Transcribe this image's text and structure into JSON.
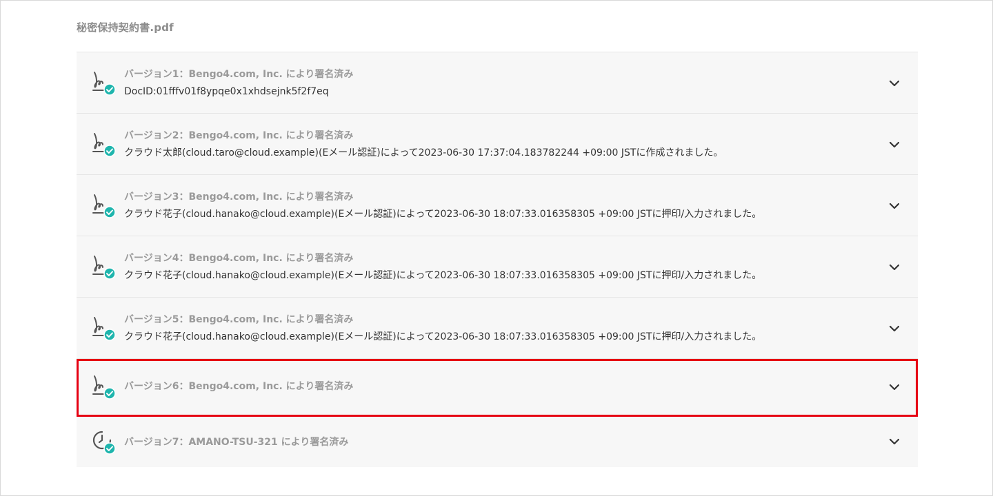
{
  "document": {
    "file_name": "秘密保持契約書.pdf"
  },
  "colors": {
    "accent_check": "#1fb5ad",
    "highlight_border": "#e60012",
    "title_text": "#9a9a9a",
    "detail_text": "#333333"
  },
  "versions": [
    {
      "icon": "signature-icon",
      "title": "バージョン1：Bengo4.com, Inc. により署名済み",
      "detail": "DocID:01fffv01f8ypqe0x1xhdsejnk5f2f7eq",
      "toggle_icon": "chevron-down-icon"
    },
    {
      "icon": "signature-icon",
      "title": "バージョン2：Bengo4.com, Inc. により署名済み",
      "detail": "クラウド太郎(cloud.taro@cloud.example)(Eメール認証)によって2023-06-30 17:37:04.183782244 +09:00 JSTに作成されました。",
      "toggle_icon": "chevron-down-icon"
    },
    {
      "icon": "signature-icon",
      "title": "バージョン3：Bengo4.com, Inc. により署名済み",
      "detail": "クラウド花子(cloud.hanako@cloud.example)(Eメール認証)によって2023-06-30 18:07:33.016358305 +09:00 JSTに押印/入力されました。",
      "toggle_icon": "chevron-down-icon"
    },
    {
      "icon": "signature-icon",
      "title": "バージョン4：Bengo4.com, Inc. により署名済み",
      "detail": "クラウド花子(cloud.hanako@cloud.example)(Eメール認証)によって2023-06-30 18:07:33.016358305 +09:00 JSTに押印/入力されました。",
      "toggle_icon": "chevron-down-icon"
    },
    {
      "icon": "signature-icon",
      "title": "バージョン5：Bengo4.com, Inc. により署名済み",
      "detail": "クラウド花子(cloud.hanako@cloud.example)(Eメール認証)によって2023-06-30 18:07:33.016358305 +09:00 JSTに押印/入力されました。",
      "toggle_icon": "chevron-down-icon"
    },
    {
      "icon": "signature-icon",
      "title": "バージョン6：Bengo4.com, Inc. により署名済み",
      "detail": "",
      "toggle_icon": "chevron-down-icon",
      "highlighted": true
    },
    {
      "icon": "timestamp-clock-icon",
      "title": "バージョン7：AMANO-TSU-321 により署名済み",
      "detail": "",
      "toggle_icon": "chevron-down-icon"
    }
  ]
}
